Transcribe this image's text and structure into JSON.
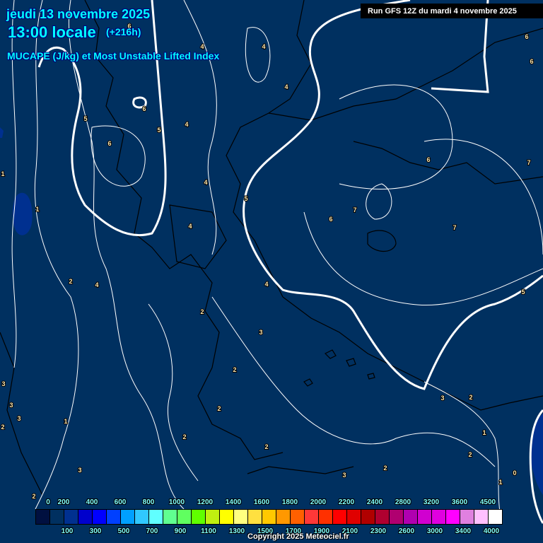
{
  "header": {
    "date": "jeudi 13 novembre 2025",
    "time": "13:00 locale",
    "lead": "(+216h)",
    "parameter": "MUCAPE (J/kg) et Most Unstable Lifted Index",
    "run": "Run GFS 12Z du mardi 4 novembre 2025"
  },
  "legend": {
    "top_labels": [
      "0",
      "200",
      "400",
      "600",
      "800",
      "1000",
      "1200",
      "1400",
      "1600",
      "1800",
      "2000",
      "2200",
      "2400",
      "2800",
      "3200",
      "3600",
      "4500"
    ],
    "bottom_labels": [
      "100",
      "300",
      "500",
      "700",
      "900",
      "1100",
      "1300",
      "1500",
      "1700",
      "1900",
      "2100",
      "2300",
      "2600",
      "3000",
      "3400",
      "4000"
    ],
    "colors": [
      "#001040",
      "#003060",
      "#003090",
      "#0000cc",
      "#0000ff",
      "#0040ff",
      "#00a0ff",
      "#30c8ff",
      "#60ffff",
      "#60ff90",
      "#60ff60",
      "#60ff00",
      "#c0f010",
      "#ffff00",
      "#ffff80",
      "#ffe040",
      "#ffc800",
      "#ff9800",
      "#ff6000",
      "#ff3838",
      "#ff3000",
      "#ff0000",
      "#e00000",
      "#b00000",
      "#b00030",
      "#b00070",
      "#b000b0",
      "#d000d0",
      "#e000e0",
      "#ff00ff",
      "#e080e0",
      "#ffc0ff",
      "#ffffff"
    ]
  },
  "contour_labels": [
    "6",
    "4",
    "4",
    "4",
    "6",
    "5",
    "4",
    "5",
    "6",
    "1",
    "4",
    "5",
    "1",
    "4",
    "6",
    "7",
    "6",
    "7",
    "7",
    "6",
    "6",
    "2",
    "4",
    "4",
    "5",
    "2",
    "3",
    "2",
    "3",
    "3",
    "3",
    "2",
    "1",
    "2",
    "2",
    "3",
    "2",
    "1",
    "2",
    "2",
    "2",
    "3",
    "3",
    "0",
    "1",
    "2"
  ],
  "colors": {
    "background": "#003060",
    "cape_low": "#003090"
  },
  "copyright": "Copyright 2025 Meteociel.fr"
}
